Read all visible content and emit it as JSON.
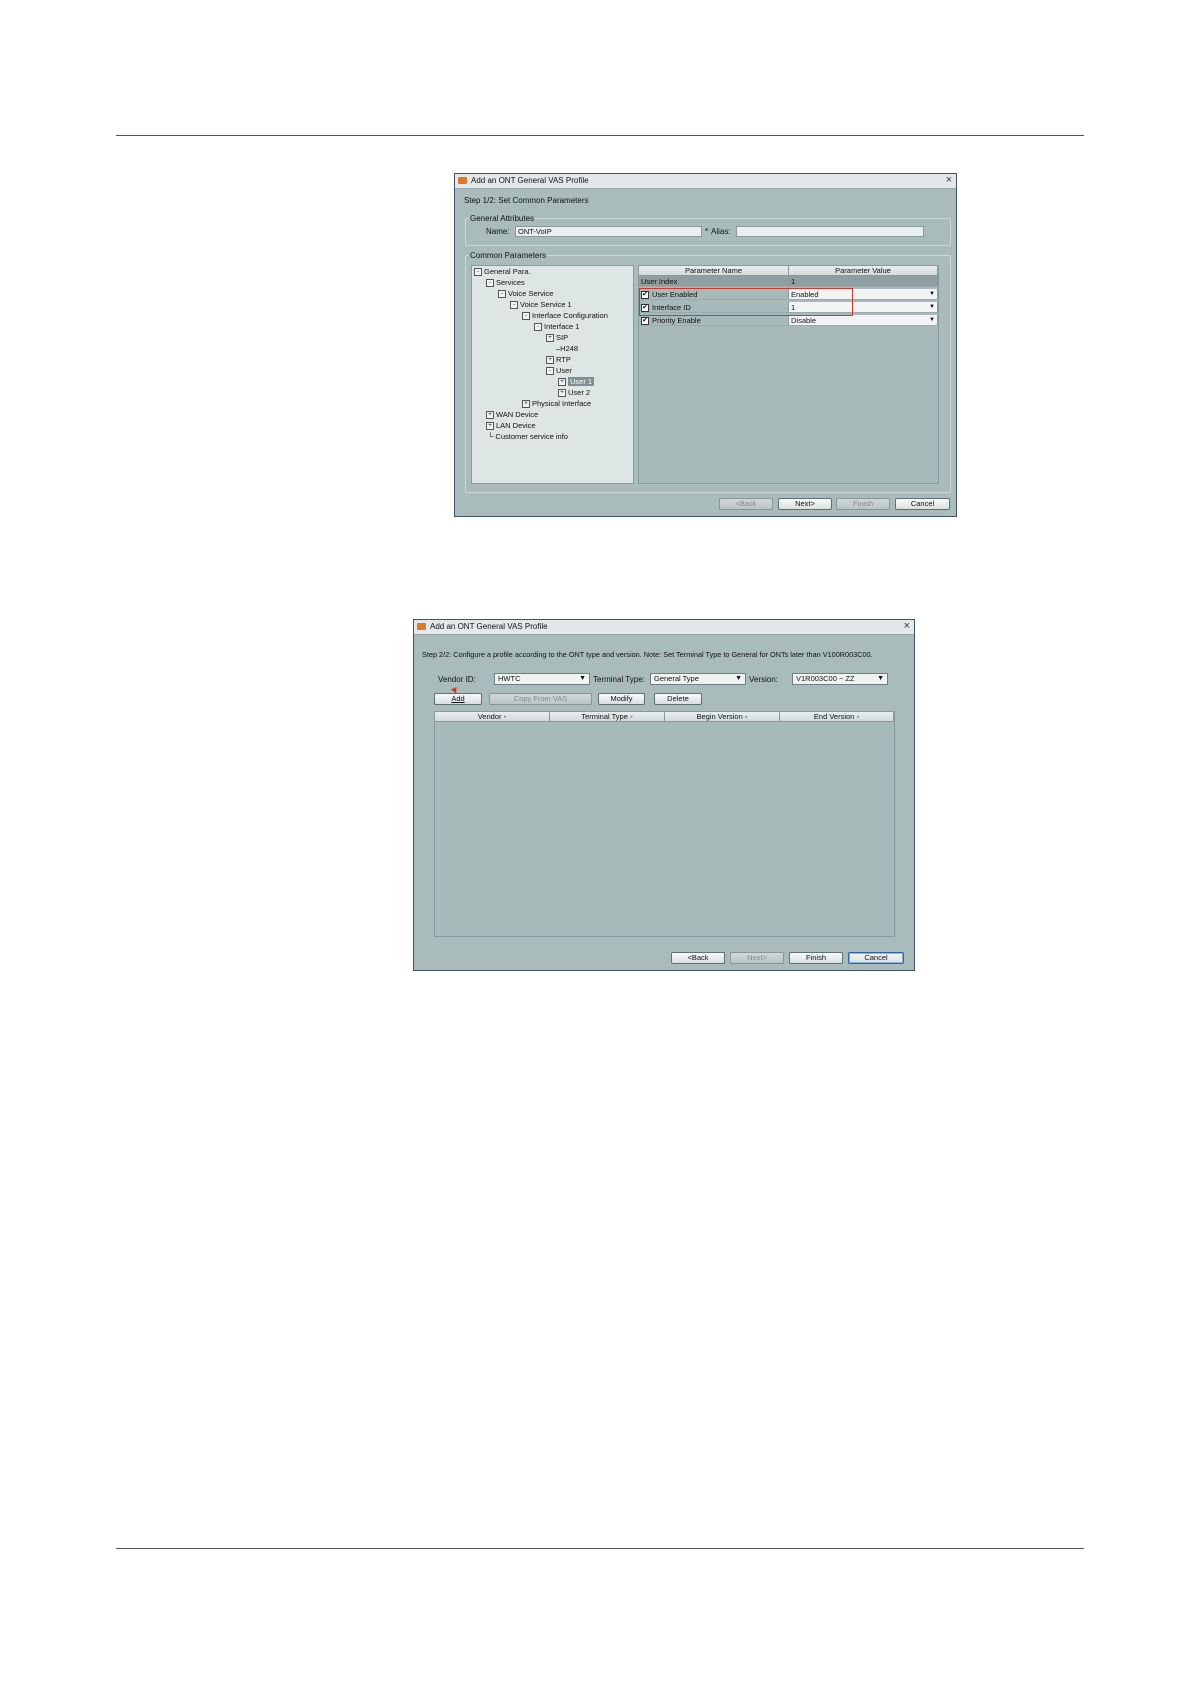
{
  "dialog1": {
    "title": "Add an ONT General VAS Profile",
    "step": "Step 1/2: Set Common Parameters",
    "general_attributes": {
      "legend": "General Attributes",
      "name_label": "Name:",
      "name_value": "ONT-VoIP",
      "alias_label": "Alias:",
      "alias_value": ""
    },
    "common_parameters": {
      "legend": "Common Parameters",
      "tree": [
        {
          "label": "General Para.",
          "toggle": "-"
        },
        {
          "label": "Services",
          "toggle": "-"
        },
        {
          "label": "Voice Service",
          "toggle": "-"
        },
        {
          "label": "Voice Service 1",
          "toggle": "-"
        },
        {
          "label": "Interface Configuration",
          "toggle": "-"
        },
        {
          "label": "Interface 1",
          "toggle": "-"
        },
        {
          "label": "SIP",
          "toggle": "+"
        },
        {
          "label": "H248",
          "toggle": ""
        },
        {
          "label": "RTP",
          "toggle": "+"
        },
        {
          "label": "User",
          "toggle": "-"
        },
        {
          "label": "User 1",
          "toggle": "+",
          "selected": true
        },
        {
          "label": "User 2",
          "toggle": "+"
        },
        {
          "label": "Physical Interface",
          "toggle": "+"
        },
        {
          "label": "WAN Device",
          "toggle": "+"
        },
        {
          "label": "LAN Device",
          "toggle": "+"
        },
        {
          "label": "Customer service info",
          "toggle": ""
        }
      ],
      "table": {
        "headers": [
          "Parameter Name",
          "Parameter Value"
        ],
        "rows": [
          {
            "name": "User Index",
            "value": "1",
            "checkbox": false,
            "dropdown": false
          },
          {
            "name": "User Enabled",
            "value": "Enabled",
            "checkbox": true,
            "dropdown": true
          },
          {
            "name": "Interface ID",
            "value": "1",
            "checkbox": true,
            "dropdown": true
          },
          {
            "name": "Priority Enable",
            "value": "Disable",
            "checkbox": true,
            "dropdown": true
          }
        ]
      }
    },
    "buttons": {
      "back": "<Back",
      "next": "Next>",
      "finish": "Finish",
      "cancel": "Cancel"
    }
  },
  "dialog2": {
    "title": "Add an ONT General VAS Profile",
    "step": "Step 2/2: Configure a profile according to the ONT type and version. Note: Set Terminal Type to General for ONTs later than V100R003C00.",
    "vendor_id_label": "Vendor ID:",
    "vendor_id_value": "HWTC",
    "terminal_type_label": "Terminal Type:",
    "terminal_type_value": "General Type",
    "version_label": "Version:",
    "version_value": "V1R003C00 ~ ZZ",
    "actions": {
      "add": "Add",
      "copy_from_vas": "Copy From VAS",
      "modify": "Modify",
      "delete": "Delete"
    },
    "table_headers": [
      "Vendor",
      "Terminal Type",
      "Begin Version",
      "End Version"
    ],
    "buttons": {
      "back": "<Back",
      "next": "Next>",
      "finish": "Finish",
      "cancel": "Cancel"
    }
  },
  "colors": {
    "dialog_bg": "#a9bcbb",
    "annotation_red": "#d9342b",
    "java_icon": "#e0782a"
  }
}
